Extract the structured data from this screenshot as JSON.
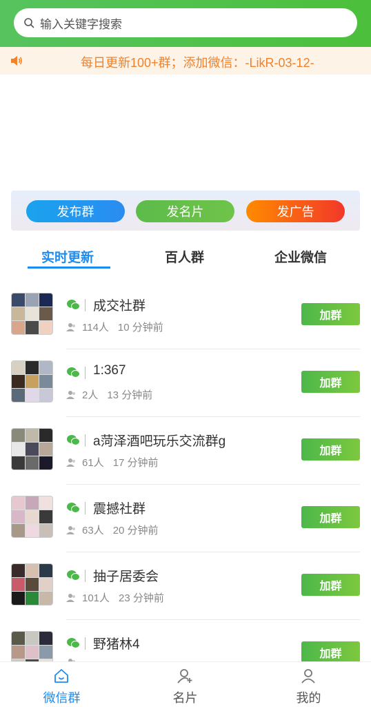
{
  "search": {
    "placeholder": "输入关键字搜索"
  },
  "notice": {
    "text": "每日更新100+群；添加微信：-LikR-03-12-"
  },
  "actions": {
    "post_group": "发布群",
    "post_card": "发名片",
    "post_ad": "发广告"
  },
  "tabs": [
    {
      "label": "实时更新",
      "active": true
    },
    {
      "label": "百人群",
      "active": false
    },
    {
      "label": "企业微信",
      "active": false
    }
  ],
  "groups": [
    {
      "name": "成交社群",
      "count": "114人",
      "time": "10 分钟前",
      "join": "加群"
    },
    {
      "name": "1:367",
      "count": "2人",
      "time": "13 分钟前",
      "join": "加群"
    },
    {
      "name": "a菏泽酒吧玩乐交流群g",
      "count": "61人",
      "time": "17 分钟前",
      "join": "加群"
    },
    {
      "name": "震撼社群",
      "count": "63人",
      "time": "20 分钟前",
      "join": "加群"
    },
    {
      "name": "抽子居委会",
      "count": "101人",
      "time": "23 分钟前",
      "join": "加群"
    },
    {
      "name": "野猪林4",
      "count": "",
      "time": "",
      "join": "加群"
    }
  ],
  "tabbar": [
    {
      "label": "微信群",
      "icon": "home-icon",
      "active": true
    },
    {
      "label": "名片",
      "icon": "add-user-icon",
      "active": false
    },
    {
      "label": "我的",
      "icon": "user-icon",
      "active": false
    }
  ],
  "colors": {
    "brand_green": "#4cc03b",
    "accent_blue": "#1d8cf0",
    "notice_orange": "#f2812b"
  }
}
